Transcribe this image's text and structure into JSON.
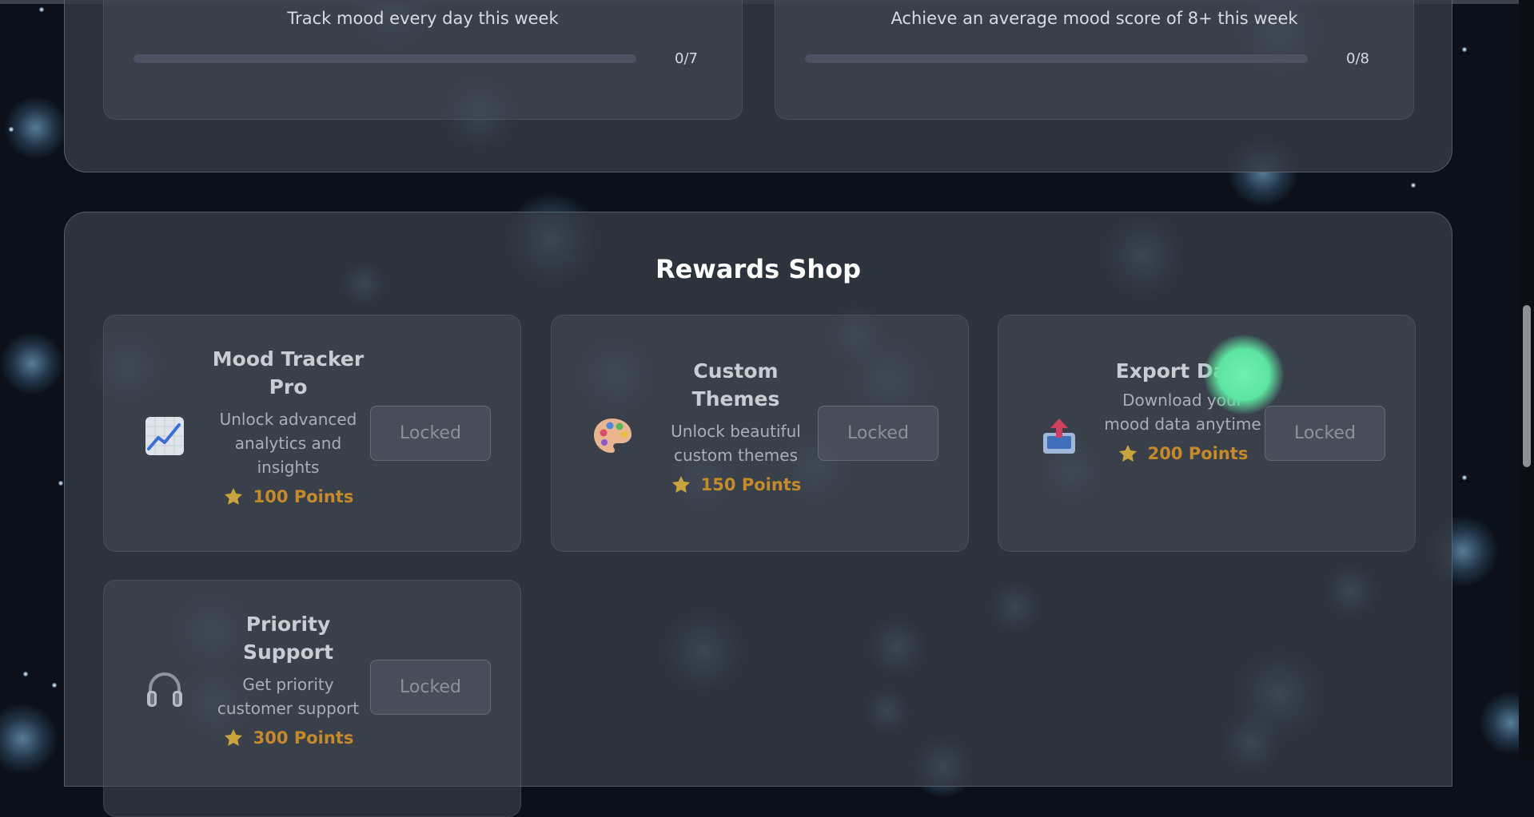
{
  "challenges": [
    {
      "description": "Track mood every day this week",
      "progress_text": "0/7",
      "progress": 0
    },
    {
      "description": "Achieve an average mood score of 8+ this week",
      "progress_text": "0/8",
      "progress": 0
    }
  ],
  "shop": {
    "title": "Rewards Shop",
    "items": [
      {
        "name": "Mood Tracker Pro",
        "description": "Unlock advanced analytics and insights",
        "points": "100 Points",
        "button": "Locked",
        "icon": "chart-increasing-icon"
      },
      {
        "name": "Custom Themes",
        "description": "Unlock beautiful custom themes",
        "points": "150 Points",
        "button": "Locked",
        "icon": "palette-icon"
      },
      {
        "name": "Export Data",
        "description": "Download your mood data anytime",
        "points": "200 Points",
        "button": "Locked",
        "icon": "outbox-tray-icon"
      },
      {
        "name": "Priority Support",
        "description": "Get priority customer support",
        "points": "300 Points",
        "button": "Locked",
        "icon": "headphones-icon"
      }
    ]
  },
  "colors": {
    "accent_points": "#c58a2a",
    "background": "#0c1119",
    "glow": "#7fc8ff",
    "orb": "#5ee4a2"
  }
}
